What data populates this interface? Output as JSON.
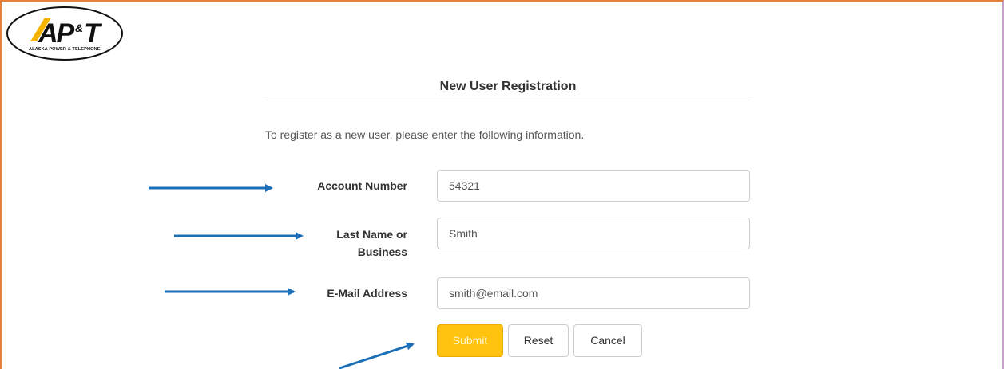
{
  "logo": {
    "name": "AP&T",
    "subtitle": "ALASKA POWER & TELEPHONE"
  },
  "page_title": "New User Registration",
  "intro": "To register as a new user, please enter the following information.",
  "form": {
    "account_number": {
      "label": "Account Number",
      "value": "54321"
    },
    "last_name": {
      "label_line1": "Last Name or",
      "label_line2": "Business",
      "value": "Smith"
    },
    "email": {
      "label": "E-Mail Address",
      "value": "smith@email.com"
    }
  },
  "buttons": {
    "submit": "Submit",
    "reset": "Reset",
    "cancel": "Cancel"
  },
  "colors": {
    "accent": "#ffc20e",
    "annotation_arrow": "#1a6fb8",
    "frame_border": "#e3823a"
  }
}
